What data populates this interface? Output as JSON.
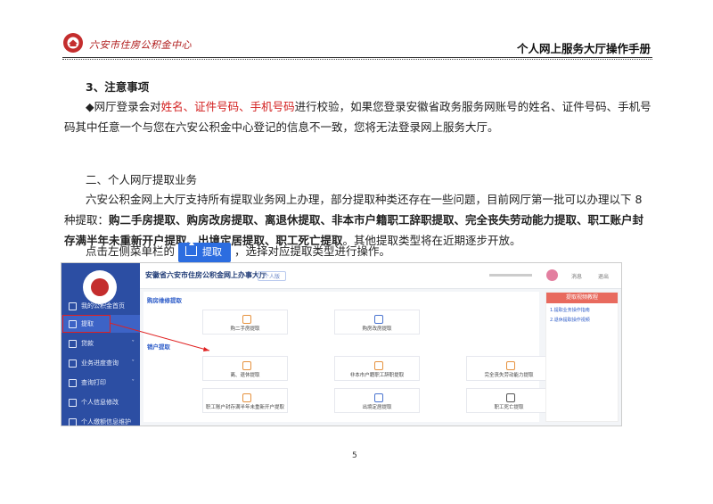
{
  "header": {
    "org_name": "六安市住房公积金中心",
    "manual_title": "个人网上服务大厅操作手册"
  },
  "notes": {
    "heading": "3、注意事项",
    "para_prefix": "◆网厅登录会对",
    "para_red": "姓名、证件号码、手机号码",
    "para_suffix": "进行校验，如果您登录安徽省政务服务网账号的姓名、证件号码、手机号码其中任意一个与您在六安公积金中心登记的信息不一致，您将无法登录网上服务大厅。"
  },
  "section2": {
    "heading": "二、个人网厅提取业务",
    "para_normal": "六安公积金网上大厅支持所有提取业务网上办理，部分提取种类还存在一些问题，目前网厅第一批可以办理以下 8 种提取：",
    "para_bold": "购二手房提取、购房改房提取、离退休提取、非本市户籍职工辞职提取、完全丧失劳动能力提取、职工账户封存满半年未重新开户提取、出境定居提取、职工死亡提取",
    "para_end": "。其他提取类型将在近期逐步开放。",
    "instr_prefix": "点击左侧菜单栏的",
    "button_label": "提取",
    "instr_suffix": "，选择对应提取类型进行操作。"
  },
  "screenshot": {
    "title": "安徽省六安市住房公积金网上办事大厅",
    "tag": "个人版",
    "msg": "消息",
    "logout": "退出",
    "sidebar": [
      {
        "label": "我的公积金首页"
      },
      {
        "label": "提取"
      },
      {
        "label": "贷款"
      },
      {
        "label": "业务进度查询"
      },
      {
        "label": "查询打印"
      },
      {
        "label": "个人信息修改"
      },
      {
        "label": "个人缴额信息维护"
      }
    ],
    "sec_purchase": "购房维修提取",
    "sec_sale": "销户提取",
    "cards": [
      "购二手房提取",
      "购房改房提取",
      "离、退休提取",
      "非本市户籍职工辞职提取",
      "完全丧失劳动能力提取",
      "职工账户封存满半年未重新开户提取",
      "出境定居提取",
      "职工死亡提取"
    ],
    "right_head": "提取视频教程",
    "right_items": [
      "1.提取业务操作指南",
      "2.退休提取操作视频"
    ]
  },
  "page_number": "5",
  "colors": {
    "accent": "#2c6de0",
    "warn": "#d32020",
    "sidebar": "#2c4ea3"
  }
}
